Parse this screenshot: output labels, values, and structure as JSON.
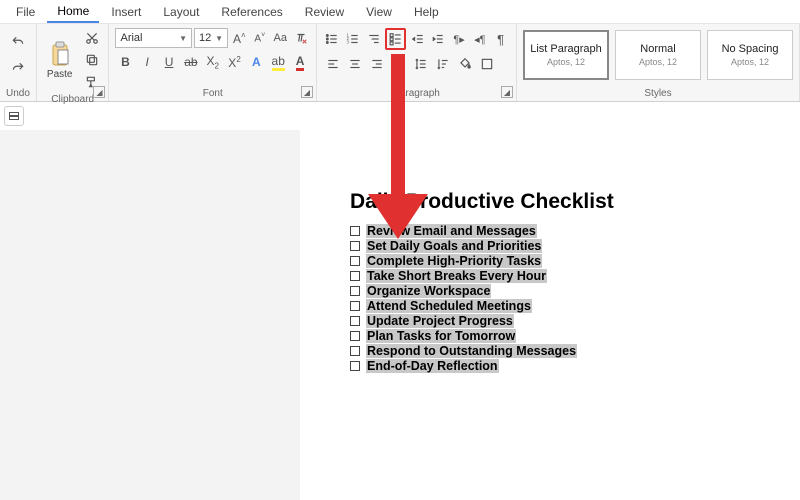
{
  "menu": {
    "file": "File",
    "home": "Home",
    "insert": "Insert",
    "layout": "Layout",
    "references": "References",
    "review": "Review",
    "view": "View",
    "help": "Help"
  },
  "groups": {
    "undo": "Undo",
    "clipboard": "Clipboard",
    "font": "Font",
    "paragraph": "Paragraph",
    "styles": "Styles"
  },
  "clipboard": {
    "paste": "Paste"
  },
  "font": {
    "family": "Arial",
    "size": "12"
  },
  "styles": {
    "tiles": [
      {
        "name": "List Paragraph",
        "meta": "Aptos, 12"
      },
      {
        "name": "Normal",
        "meta": "Aptos, 12"
      },
      {
        "name": "No Spacing",
        "meta": "Aptos, 12"
      }
    ]
  },
  "document": {
    "title": "Daily Productive Checklist",
    "items": [
      "Review Email and Messages",
      "Set Daily Goals and Priorities",
      " Complete High-Priority Tasks",
      "Take Short Breaks Every Hour",
      "Organize Workspace",
      " Attend Scheduled Meetings",
      "Update Project Progress",
      " Plan Tasks for Tomorrow",
      "Respond to Outstanding Messages",
      "End-of-Day Reflection"
    ]
  }
}
